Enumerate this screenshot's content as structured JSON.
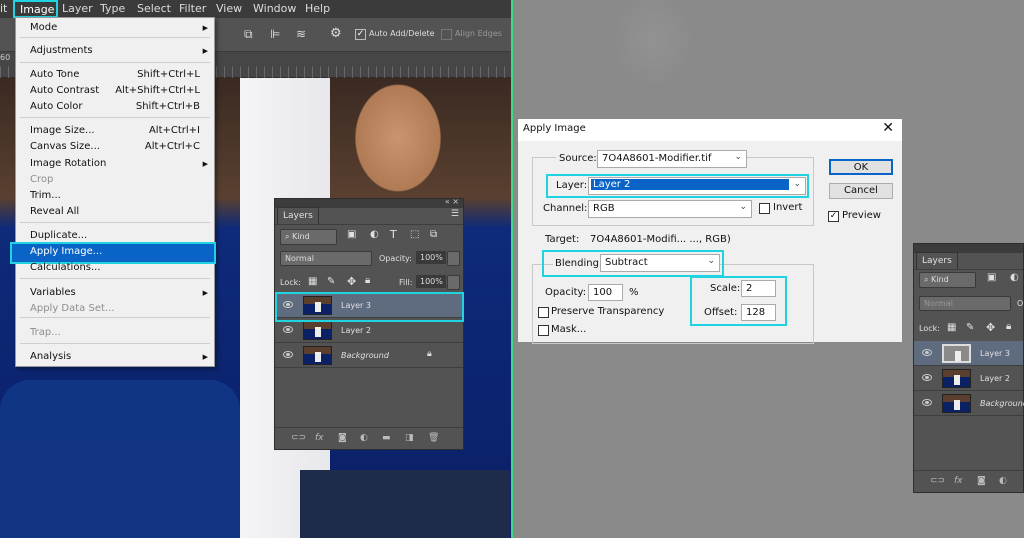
{
  "menubar": {
    "partial": "it",
    "items": [
      "Image",
      "Layer",
      "Type",
      "Select",
      "Filter",
      "View",
      "Window",
      "Help"
    ]
  },
  "options": {
    "auto_add_delete": "Auto Add/Delete",
    "align_edges": "Align Edges",
    "zoom_partial": "60"
  },
  "image_menu": {
    "items": [
      {
        "label": "Mode",
        "arrow": true
      },
      {
        "label": "Adjustments",
        "arrow": true
      },
      {
        "label": "Auto Tone",
        "shortcut": "Shift+Ctrl+L"
      },
      {
        "label": "Auto Contrast",
        "shortcut": "Alt+Shift+Ctrl+L"
      },
      {
        "label": "Auto Color",
        "shortcut": "Shift+Ctrl+B"
      },
      {
        "label": "Image Size...",
        "shortcut": "Alt+Ctrl+I"
      },
      {
        "label": "Canvas Size...",
        "shortcut": "Alt+Ctrl+C"
      },
      {
        "label": "Image Rotation",
        "arrow": true
      },
      {
        "label": "Crop",
        "disabled": true
      },
      {
        "label": "Trim..."
      },
      {
        "label": "Reveal All"
      },
      {
        "label": "Duplicate..."
      },
      {
        "label": "Apply Image...",
        "highlighted": true
      },
      {
        "label": "Calculations..."
      },
      {
        "label": "Variables",
        "arrow": true
      },
      {
        "label": "Apply Data Set...",
        "disabled": true
      },
      {
        "label": "Trap...",
        "disabled": true
      },
      {
        "label": "Analysis",
        "arrow": true
      }
    ]
  },
  "layers_left": {
    "tab": "Layers",
    "kind": "Kind",
    "blend": "Normal",
    "opacity_label": "Opacity:",
    "opacity": "100%",
    "lock_label": "Lock:",
    "fill_label": "Fill:",
    "fill": "100%",
    "layers": [
      {
        "name": "Layer 3",
        "selected": true
      },
      {
        "name": "Layer 2"
      },
      {
        "name": "Background",
        "locked": true
      }
    ],
    "footer_fx": "fx"
  },
  "dialog": {
    "title": "Apply Image",
    "source_label": "Source:",
    "source": "7O4A8601-Modifier.tif",
    "layer_label": "Layer:",
    "layer": "Layer 2",
    "channel_label": "Channel:",
    "channel": "RGB",
    "invert": "Invert",
    "target_label": "Target:",
    "target": "7O4A8601-Modifi... ..., RGB)",
    "blending_label": "Blending:",
    "blending": "Subtract",
    "opacity_label": "Opacity:",
    "opacity": "100",
    "percent": "%",
    "preserve": "Preserve Transparency",
    "mask": "Mask...",
    "scale_label": "Scale:",
    "scale": "2",
    "offset_label": "Offset:",
    "offset": "128",
    "ok": "OK",
    "cancel": "Cancel",
    "preview": "Preview",
    "preview_checked": true
  },
  "layers_right": {
    "tab": "Layers",
    "kind": "Kind",
    "blend": "Normal",
    "opacity_partial": "O",
    "lock_label": "Lock:",
    "layers": [
      {
        "name": "Layer 3",
        "selected": true
      },
      {
        "name": "Layer 2"
      },
      {
        "name": "Background"
      }
    ],
    "footer_fx": "fx"
  },
  "colors": {
    "highlight": "#1fd3e0",
    "menu_selection": "#0a64c8",
    "divider": "#3ddc84"
  }
}
